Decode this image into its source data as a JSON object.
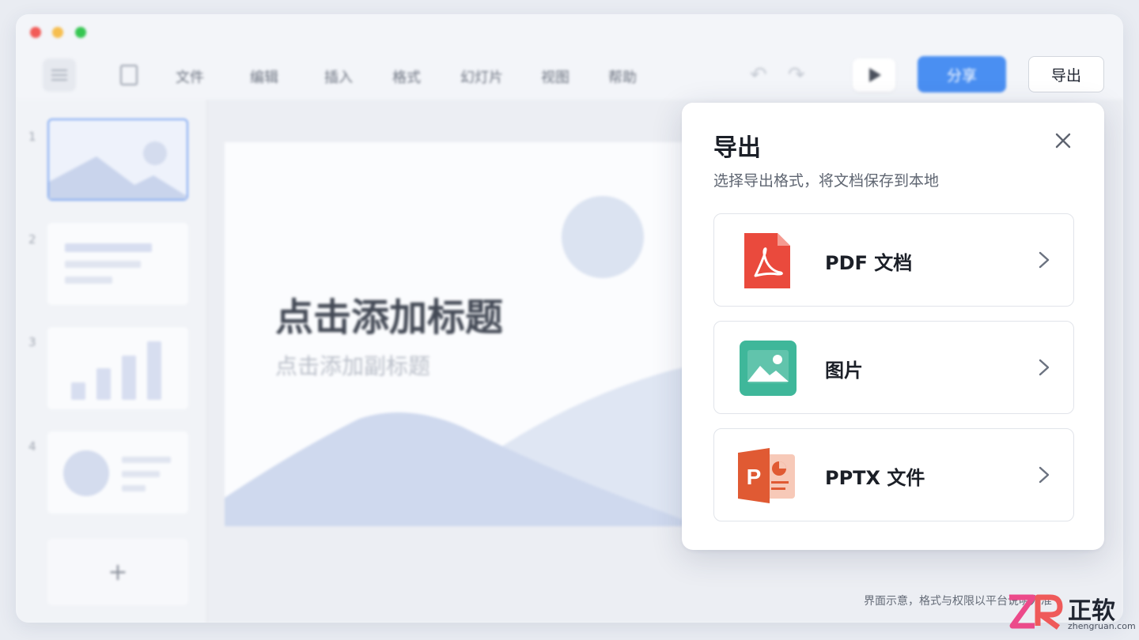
{
  "window": {
    "menu": [
      "文件",
      "编辑",
      "插入",
      "格式",
      "幻灯片",
      "视图",
      "帮助"
    ],
    "share_label": "分享",
    "export_label": "导出"
  },
  "sidebar": {
    "slides": [
      {
        "number": "1",
        "kind": "landscape"
      },
      {
        "number": "2",
        "kind": "text-lines"
      },
      {
        "number": "3",
        "kind": "bar-chart"
      },
      {
        "number": "4",
        "kind": "circle-lines"
      }
    ],
    "add_symbol": "+"
  },
  "slide": {
    "title": "点击添加标题",
    "subtitle": "点击添加副标题"
  },
  "dialog": {
    "title": "导出",
    "subtitle": "选择导出格式，将文档保存到本地",
    "options": [
      {
        "label": "PDF 文档",
        "icon": "pdf-icon",
        "color": "#ea4a3d"
      },
      {
        "label": "图片",
        "icon": "image-icon",
        "color": "#3fb79a"
      },
      {
        "label": "PPTX 文件",
        "icon": "pptx-icon",
        "color": "#e05a33"
      }
    ]
  },
  "footnote": "界面示意，格式与权限以平台说明为准",
  "watermark": {
    "brand": "正软",
    "url": "zhengruan.com"
  },
  "colors": {
    "accent": "#4a8ff2",
    "background": "#e9ecf2"
  }
}
